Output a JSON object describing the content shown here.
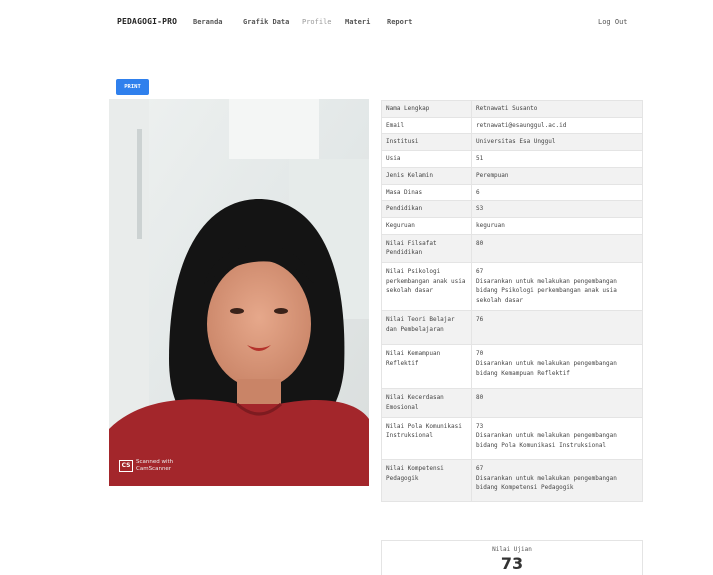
{
  "nav": {
    "brand": "PEDAGOGI-PRO",
    "items": [
      {
        "label": "Beranda",
        "active": false
      },
      {
        "label": "Grafik Data",
        "active": false
      },
      {
        "label": "Profile",
        "active": true
      },
      {
        "label": "Materi",
        "active": false
      },
      {
        "label": "Report",
        "active": false
      }
    ],
    "logout": "Log Out"
  },
  "print_label": "PRINT",
  "photo": {
    "badge_logo": "CS",
    "badge_line1": "Scanned with",
    "badge_line2": "CamScanner"
  },
  "profile": {
    "rows": [
      {
        "label": "Nama Lengkap",
        "value": "Retnawati Susanto"
      },
      {
        "label": "Email",
        "value": "retnawati@esaunggul.ac.id"
      },
      {
        "label": "Institusi",
        "value": "Universitas Esa Unggul"
      },
      {
        "label": "Usia",
        "value": "51"
      },
      {
        "label": "Jenis Kelamin",
        "value": "Perempuan"
      },
      {
        "label": "Masa Dinas",
        "value": "6"
      },
      {
        "label": "Pendidikan",
        "value": "S3"
      },
      {
        "label": "Keguruan",
        "value": "keguruan"
      },
      {
        "label": "Nilai Filsafat Pendidikan",
        "value": "80"
      },
      {
        "label": "Nilai Psikologi perkembangan anak usia sekolah dasar",
        "value": "67",
        "advice": "Disarankan untuk melakukan pengembangan bidang Psikologi perkembangan anak usia sekolah dasar"
      },
      {
        "label": "Nilai Teori Belajar dan Pembelajaran",
        "value": "76"
      },
      {
        "label": "Nilai Kemampuan Reflektif",
        "value": "70",
        "advice": "Disarankan untuk melakukan pengembangan bidang Kemampuan Reflektif"
      },
      {
        "label": "Nilai Kecerdasan Emosional",
        "value": "80"
      },
      {
        "label": "Nilai Pola Komunikasi Instruksional",
        "value": "73",
        "advice": "Disarankan untuk melakukan pengembangan bidang Pola Komunikasi Instruksional"
      },
      {
        "label": "Nilai Kompetensi Pedagogik",
        "value": "67",
        "advice": "Disarankan untuk melakukan pengembangan bidang Kompetensi Pedagogik"
      }
    ]
  },
  "exam": {
    "label": "Nilai Ujian",
    "value": "73"
  }
}
